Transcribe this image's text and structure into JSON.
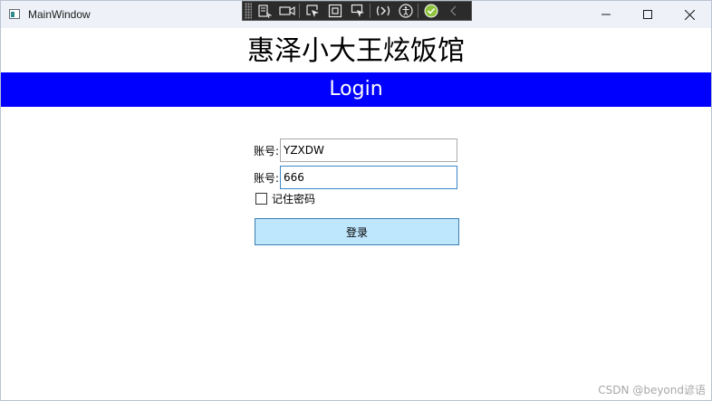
{
  "window": {
    "title": "MainWindow"
  },
  "debug_toolbar": {
    "icons": [
      "live-visual-tree-icon",
      "video-icon",
      "select-element-icon",
      "display-layout-adorners-icon",
      "track-focused-element-icon",
      "hot-reload-icon",
      "accessibility-icon",
      "hot-reload-status-icon",
      "collapse-icon"
    ]
  },
  "app": {
    "title": "惠泽小大王炫饭馆",
    "banner": "Login"
  },
  "form": {
    "username_label": "账号:",
    "username_value": "YZXDW",
    "password_label": "账号:",
    "password_value": "666",
    "remember_label": "记住密码",
    "remember_checked": false,
    "login_button": "登录"
  },
  "watermark": "CSDN @beyond谚语",
  "colors": {
    "banner": "#0000ff",
    "button": "#bee6fd",
    "titlebar": "#eef2f8"
  }
}
